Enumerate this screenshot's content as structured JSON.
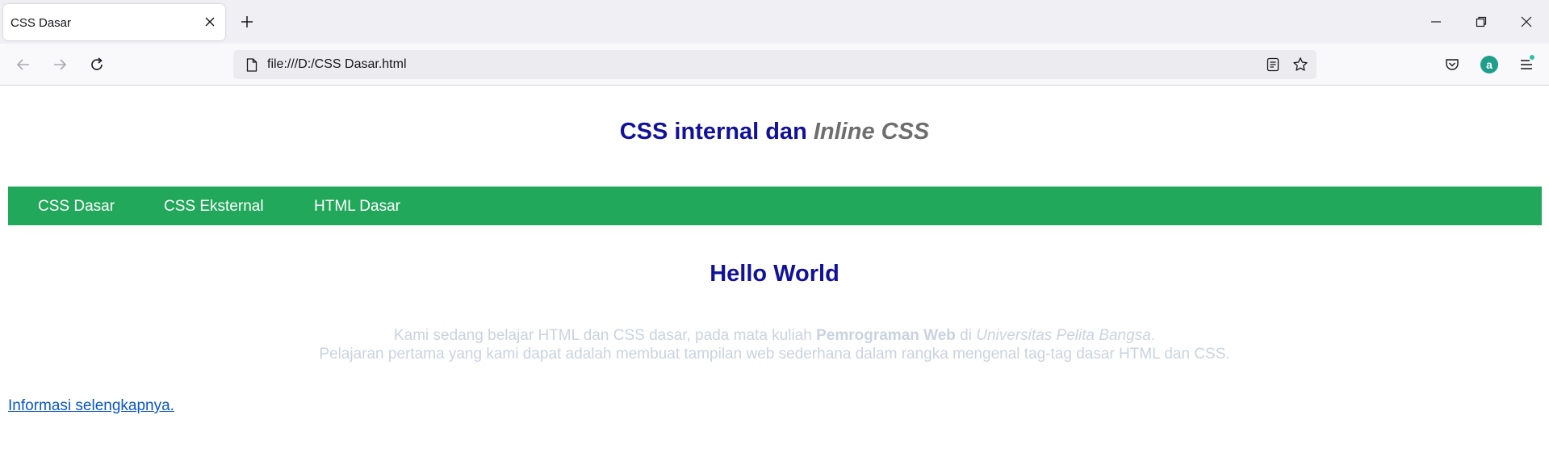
{
  "browser": {
    "tab_title": "CSS Dasar",
    "url": "file:///D:/CSS Dasar.html",
    "icons": {
      "tab_close": "close-icon",
      "new_tab": "plus-icon",
      "back": "arrow-left-icon",
      "forward": "arrow-right-icon",
      "reload": "reload-icon",
      "page": "page-icon",
      "reader": "reader-view-icon",
      "bookmark": "star-icon",
      "pocket": "pocket-icon",
      "account": "account-icon",
      "menu": "hamburger-menu-icon",
      "minimize": "minimize-icon",
      "restore": "restore-icon",
      "close_window": "close-window-icon"
    },
    "account_letter": "a"
  },
  "page": {
    "heading_part1": "CSS internal dan ",
    "heading_part2": "Inline CSS",
    "menu_items": [
      "CSS Dasar",
      "CSS Eksternal",
      "HTML Dasar"
    ],
    "hello": "Hello World",
    "para_line1_a": "Kami sedang belajar HTML dan CSS dasar, pada mata kuliah ",
    "para_line1_bold": "Pemrograman Web",
    "para_line1_b": " di ",
    "para_line1_italic": "Universitas Pelita Bangsa",
    "para_line1_end": ".",
    "para_line2": "Pelajaran pertama yang kami dapat adalah membuat tampilan web sederhana dalam rangka mengenal tag-tag dasar HTML dan CSS.",
    "more_link": "Informasi selengkapnya."
  },
  "colors": {
    "heading": "#11119a",
    "heading_inline": "#6e6e6e",
    "menu_bg": "#22a85b",
    "menu_text": "#ffffff",
    "paragraph": "#c9d3df",
    "link": "#0a56c8",
    "account": "#1f9e8c"
  }
}
